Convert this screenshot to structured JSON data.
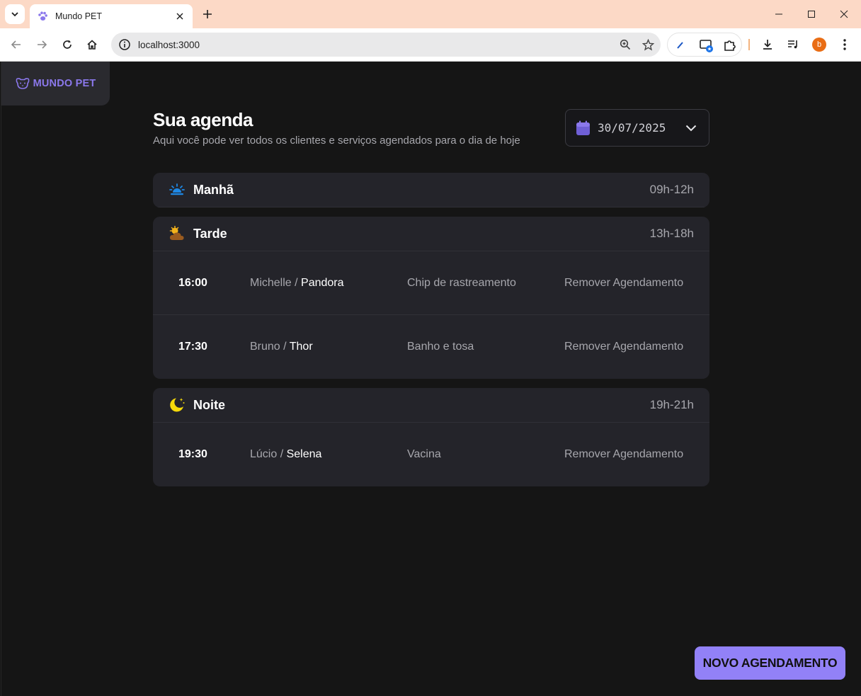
{
  "browser": {
    "tab_title": "Mundo PET",
    "url": "localhost:3000",
    "profile_initial": "b"
  },
  "brand": {
    "name": "MUNDO PET",
    "color": "#8b78ec"
  },
  "header": {
    "title": "Sua agenda",
    "subtitle": "Aqui você pode ver todos os clientes e serviços agendados para o dia de hoje"
  },
  "date_picker": {
    "value": "30/07/2025"
  },
  "periods": [
    {
      "name": "Manhã",
      "range": "09h-12h",
      "icon": "sunrise-icon",
      "appointments": []
    },
    {
      "name": "Tarde",
      "range": "13h-18h",
      "icon": "cloud-sun-icon",
      "appointments": [
        {
          "time": "16:00",
          "client": "Michelle",
          "pet": "Pandora",
          "service": "Chip de rastreamento",
          "action": "Remover Agendamento"
        },
        {
          "time": "17:30",
          "client": "Bruno",
          "pet": "Thor",
          "service": "Banho e tosa",
          "action": "Remover Agendamento"
        }
      ]
    },
    {
      "name": "Noite",
      "range": "19h-21h",
      "icon": "moon-stars-icon",
      "appointments": [
        {
          "time": "19:30",
          "client": "Lúcio",
          "pet": "Selena",
          "service": "Vacina",
          "action": "Remover Agendamento"
        }
      ]
    }
  ],
  "cta": {
    "label": "NOVO AGENDAMENTO",
    "color": "#9281f7"
  },
  "colors": {
    "background": "#151515",
    "card": "#24242a",
    "accent": "#8b78ec",
    "muted_text": "#a7a7ad"
  }
}
